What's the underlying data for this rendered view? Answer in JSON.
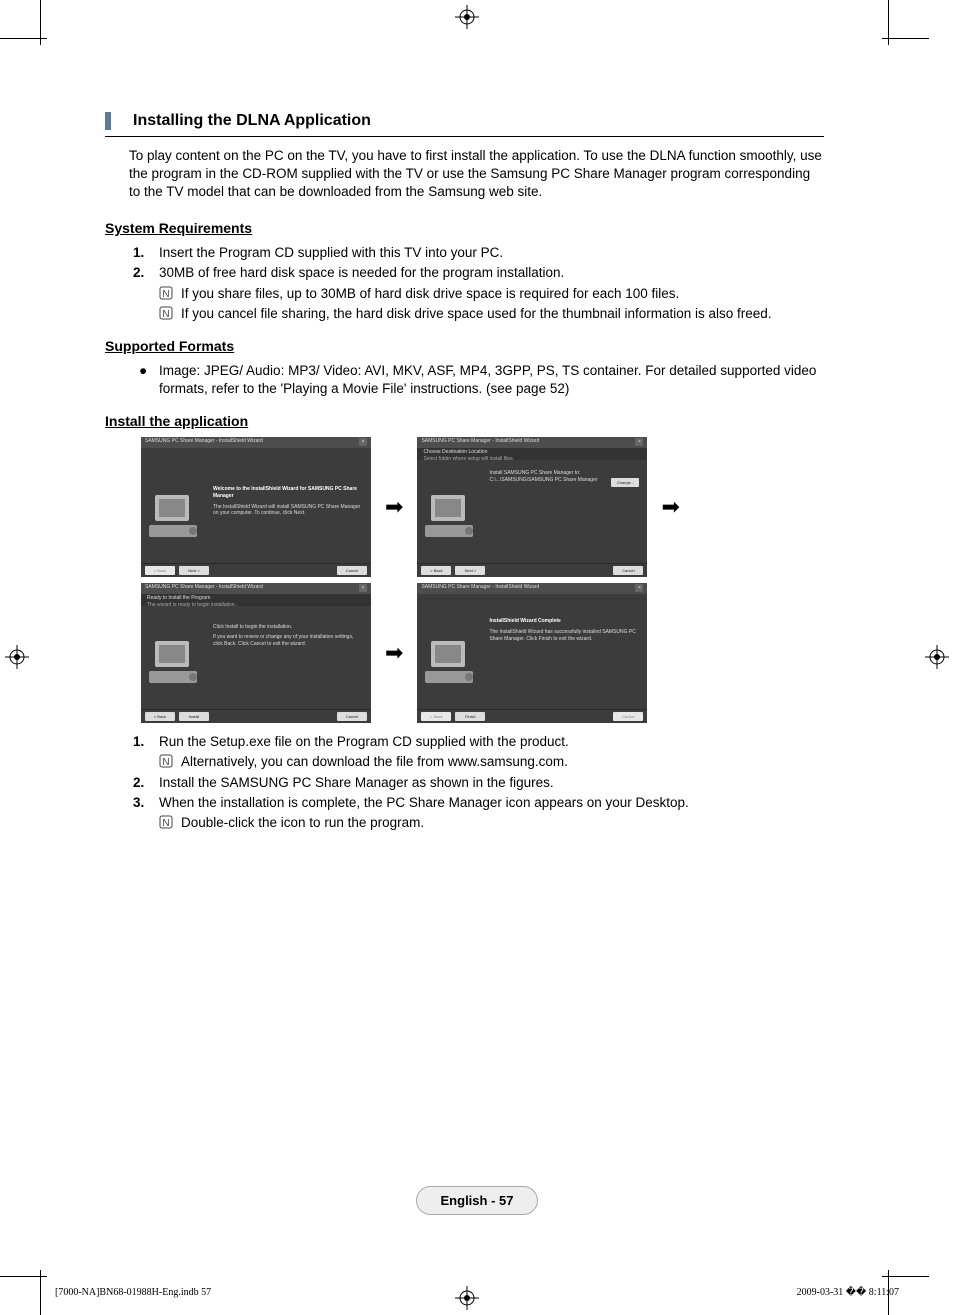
{
  "section_title": "Installing the DLNA Application",
  "intro": "To play content on the PC on the TV, you have to first install the application. To use the DLNA function smoothly, use the program in the CD-ROM supplied with the TV or use the Samsung PC Share Manager program corresponding to the TV model that can be downloaded from the Samsung web site.",
  "sys_req": {
    "heading": "System Requirements",
    "items": [
      {
        "num": "1.",
        "text": "Insert the Program CD supplied with this TV into your PC."
      },
      {
        "num": "2.",
        "text": "30MB of free hard disk space is needed for the program  installation."
      }
    ],
    "notes": [
      "If you share files, up to 30MB of hard disk drive space is required for each 100 files.",
      "If you cancel file sharing, the hard disk drive space used for the thumbnail information is also freed."
    ]
  },
  "formats": {
    "heading": "Supported Formats",
    "bullet": "Image: JPEG/ Audio: MP3/ Video: AVI, MKV, ASF, MP4, 3GPP, PS, TS container. For detailed supported video formats, refer to the 'Playing a Movie File' instructions. (see page 52)"
  },
  "install": {
    "heading": "Install the application",
    "steps": [
      {
        "num": "1.",
        "text": "Run the Setup.exe file on the Program CD supplied with the product.",
        "note": "Alternatively, you can download the file from www.samsung.com."
      },
      {
        "num": "2.",
        "text": "Install the SAMSUNG PC Share Manager as shown in the figures."
      },
      {
        "num": "3.",
        "text": "When the installation is complete, the PC Share Manager icon appears on your Desktop.",
        "note": "Double-click the icon to run the program."
      }
    ]
  },
  "installer": {
    "titlebar": "SAMSUNG PC Share Manager - InstallShield Wizard",
    "step1": {
      "title": "Welcome to the InstallShield Wizard for SAMSUNG PC Share Manager",
      "body": "The InstallShield Wizard will install SAMSUNG PC Share Manager on your computer. To continue, click Next."
    },
    "step2": {
      "header": "Choose Destination Location",
      "subheader": "Select folder where setup will install files.",
      "line1": "Install SAMSUNG PC Share Manager to:",
      "line2": "C:\\...\\SAMSUNG\\SAMSUNG PC Share Manager",
      "change": "Change..."
    },
    "step3": {
      "header": "Ready to Install the Program",
      "subheader": "The wizard is ready to begin installation.",
      "line1": "Click Install to begin the installation.",
      "line2": "If you want to review or change any of your installation settings, click Back. Click Cancel to exit the wizard."
    },
    "step4": {
      "title": "InstallShield Wizard Complete",
      "body": "The InstallShield Wizard has successfully installed SAMSUNG PC Share Manager. Click Finish to exit the wizard."
    },
    "buttons": {
      "back": "< Back",
      "next": "Next >",
      "install": "Install",
      "finish": "Finish",
      "cancel": "Cancel",
      "close": "×"
    }
  },
  "footer": {
    "page": "English - 57"
  },
  "print": {
    "left": "[7000-NA]BN68-01988H-Eng.indb   57",
    "right": "2009-03-31   �� 8:11:07"
  }
}
